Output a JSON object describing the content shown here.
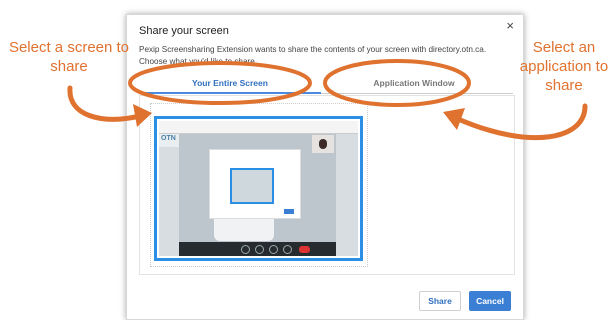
{
  "dialog": {
    "title": "Share your screen",
    "close_glyph": "×",
    "description": "Pexip Screensharing Extension wants to share the contents of your screen with directory.otn.ca. Choose what you'd like to share.",
    "tabs": [
      {
        "label": "Your Entire Screen",
        "active": true
      },
      {
        "label": "Application Window",
        "active": false
      }
    ],
    "buttons": {
      "share": "Share",
      "cancel": "Cancel"
    },
    "accent_color": "#3a7fd4"
  },
  "annotations": {
    "left": "Select a screen to share",
    "right": "Select an application to share",
    "color": "#e0722f"
  }
}
